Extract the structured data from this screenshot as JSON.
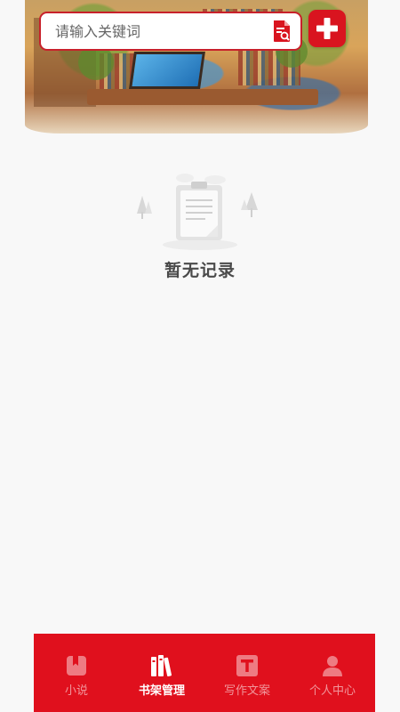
{
  "search": {
    "placeholder": "请输入关键词",
    "value": ""
  },
  "empty_state": {
    "message": "暂无记录"
  },
  "tabbar": {
    "tabs": [
      {
        "label": "小说",
        "icon": "bookmark-book-icon",
        "active": false
      },
      {
        "label": "书架管理",
        "icon": "bookshelf-icon",
        "active": true
      },
      {
        "label": "写作文案",
        "icon": "text-t-icon",
        "active": false
      },
      {
        "label": "个人中心",
        "icon": "person-icon",
        "active": false
      }
    ]
  },
  "colors": {
    "brand": "#d9141f",
    "tabbar_bg": "#e0101d",
    "search_border": "#c8212b",
    "empty_text": "#4a4a4a"
  }
}
